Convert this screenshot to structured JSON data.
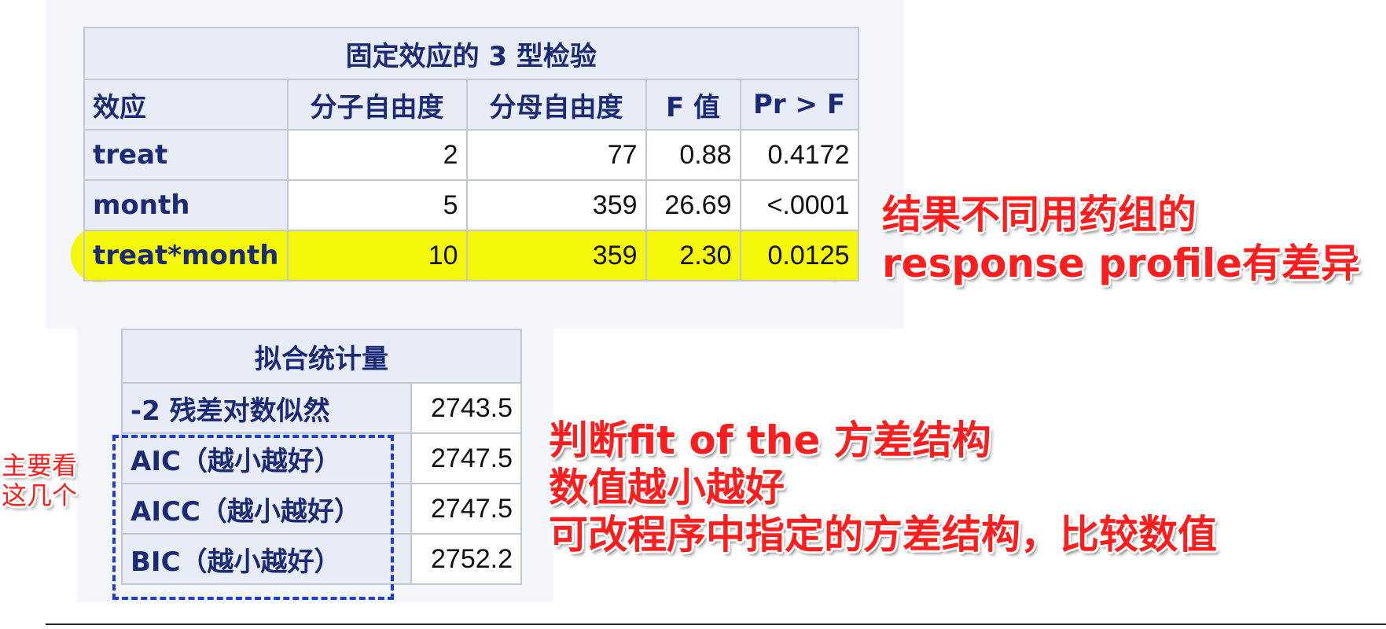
{
  "type3_table": {
    "title": "固定效应的 3 型检验",
    "headers": [
      "效应",
      "分子自由度",
      "分母自由度",
      "F 值",
      "Pr > F"
    ],
    "rows": [
      {
        "effect": "treat",
        "num_df": "2",
        "den_df": "77",
        "f_value": "0.88",
        "p_value": "0.4172"
      },
      {
        "effect": "month",
        "num_df": "5",
        "den_df": "359",
        "f_value": "26.69",
        "p_value": "<.0001"
      },
      {
        "effect": "treat*month",
        "num_df": "10",
        "den_df": "359",
        "f_value": "2.30",
        "p_value": "0.0125"
      }
    ],
    "highlight_color": "#f5f70a"
  },
  "fit_table": {
    "title": "拟合统计量",
    "rows": [
      {
        "label": "-2 残差对数似然",
        "value": "2743.5"
      },
      {
        "label": "AIC（越小越好）",
        "value": "2747.5"
      },
      {
        "label": "AICC（越小越好）",
        "value": "2747.5"
      },
      {
        "label": "BIC（越小越好）",
        "value": "2752.2"
      }
    ]
  },
  "annotations": {
    "right": [
      "结果不同用药组的",
      "response profile有差异"
    ],
    "middle": [
      "判断fit of the 方差结构",
      "数值越小越好",
      "可改程序中指定的方差结构，比较数值"
    ],
    "left": [
      "主要看",
      "这几个"
    ],
    "color": "#ff1d1d",
    "box_color": "#1a3ce0"
  }
}
